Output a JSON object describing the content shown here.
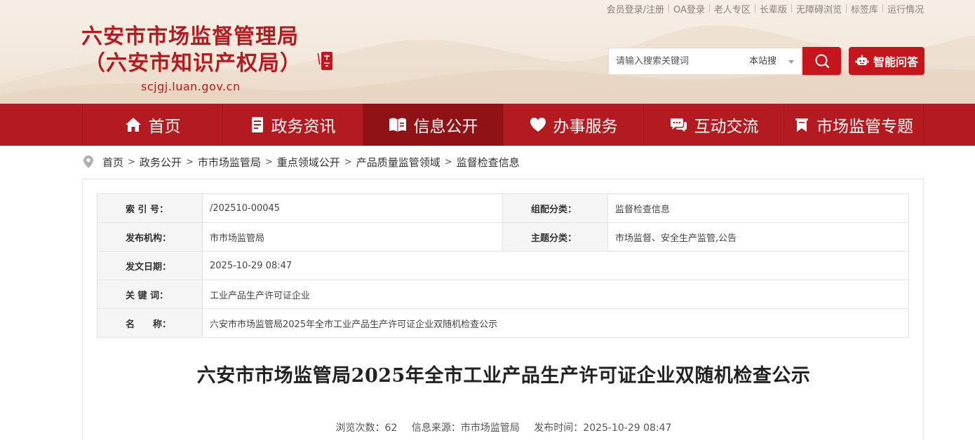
{
  "top_links": [
    "会员登录/注册",
    "OA登录",
    "老人专区",
    "长辈版",
    "无障碍浏览",
    "标签库",
    "运行情况"
  ],
  "logo": {
    "line1": "六安市市场监督管理局",
    "line2": "（六安市知识产权局）",
    "domain": "scjgj.luan.gov.cn",
    "seal_icon": "luan-seal-icon"
  },
  "search": {
    "placeholder": "请输入搜索关键词",
    "scope": "本站搜",
    "button_icon": "search-icon"
  },
  "ai_button": {
    "label": "智能问答",
    "icon": "robot-icon"
  },
  "nav": [
    {
      "label": "首页",
      "icon": "home-icon"
    },
    {
      "label": "政务资讯",
      "icon": "document-icon"
    },
    {
      "label": "信息公开",
      "icon": "open-book-icon"
    },
    {
      "label": "办事服务",
      "icon": "heart-icon"
    },
    {
      "label": "互动交流",
      "icon": "chat-icon"
    },
    {
      "label": "市场监管专题",
      "icon": "bookmark-icon"
    }
  ],
  "nav_active": "信息公开",
  "breadcrumb": [
    "首页",
    "政务公开",
    "市市场监管局",
    "重点领域公开",
    "产品质量监管领域",
    "监督检查信息"
  ],
  "meta": {
    "index_label": "索 引 号：",
    "index_value": "/202510-00045",
    "category_label": "组配分类：",
    "category_value": "监督检查信息",
    "publisher_label": "发布机构：",
    "publisher_value": "市市场监管局",
    "topic_label": "主题分类：",
    "topic_value": "市场监督、安全生产监管,公告",
    "date_label": "发文日期：",
    "date_value": "2025-10-29 08:47",
    "keywords_label": "关 键 词：",
    "keywords_value": "工业产品生产许可证企业",
    "name_label": "名　　称：",
    "name_value": "六安市市场监管局2025年全市工业产品生产许可证企业双随机检查公示"
  },
  "doc": {
    "title": "六安市市场监管局2025年全市工业产品生产许可证企业双随机检查公示",
    "views": "浏览次数：62",
    "source": "信息来源：市市场监管局",
    "published": "发布时间：2025-10-29 08:47"
  },
  "colors": {
    "brand_red": "#b31b20",
    "button_red": "#c4161c",
    "active_nav": "#8f1216"
  }
}
